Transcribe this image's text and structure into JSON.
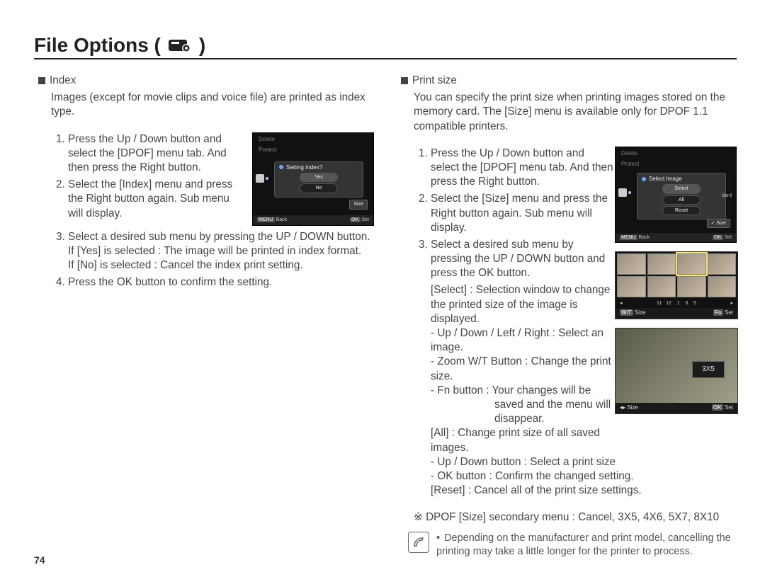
{
  "title": "File Options (",
  "title_close": ")",
  "page_number": "74",
  "left": {
    "heading": "Index",
    "intro": "Images (except for movie clips and voice file) are printed as index type.",
    "steps": {
      "s1": "Press the Up / Down button and select the [DPOF] menu tab. And then press the Right button.",
      "s2": "Select the [Index] menu and press the Right button again. Sub menu will display.",
      "s3a": "Select a desired sub menu by pressing the UP / DOWN button.",
      "s3b": "If [Yes] is selected : The image will be printed in index format.",
      "s3c": "If [No] is selected   : Cancel the index print setting.",
      "s4": "Press the OK button to confirm the setting."
    },
    "sshot": {
      "menu1": "Delete",
      "menu2": "Protect",
      "popup_title": "Setting Index?",
      "opt_yes": "Yes",
      "opt_no": "No",
      "right_tag": "Size",
      "footer_left": "Back",
      "footer_left_icon": "MENU",
      "footer_right": "Set",
      "footer_right_icon": "OK"
    }
  },
  "right": {
    "heading": "Print size",
    "intro": "You can specify the print size when printing images stored on the memory card. The [Size] menu is available only for DPOF 1.1 compatible printers.",
    "steps": {
      "s1": "Press the Up / Down button and select the [DPOF] menu tab. And then press the Right button.",
      "s2": "Select the [Size] menu and press the Right button again. Sub menu will display.",
      "s3a": "Select a desired sub menu by pressing the UP / DOWN button and press the OK button.",
      "s3_select_label": "[Select] : Selection window to change the printed size of the image is displayed.",
      "s3_b1": "- Up / Down / Left / Right : Select an image.",
      "s3_b2": "- Zoom W/T Button : Change the print size.",
      "s3_b3a": "- Fn button : Your changes will be",
      "s3_b3b": "saved and the menu will disappear.",
      "s3_all": "[All] : Change print size of all saved images.",
      "s3_all_b1": "- Up / Down button : Select a print size",
      "s3_all_b2": "- OK button : Confirm the changed setting.",
      "s3_reset": "[Reset] : Cancel all of the print size settings."
    },
    "secondary": "※ DPOF [Size] secondary menu : Cancel, 3X5, 4X6, 5X7, 8X10",
    "note": "Depending on the manufacturer and print model, cancelling the printing may take a little longer for the printer to process.",
    "sshot": {
      "menu1": "Delete",
      "menu2": "Protect",
      "popup_title": "Select Image",
      "opt1": "Select",
      "opt2": "All",
      "opt3": "Reset",
      "side_label": "dard",
      "right_tag": "✓ Size",
      "footer_left": "Back",
      "footer_left_icon": "MENU",
      "footer_right": "Set",
      "footer_right_icon": "OK"
    },
    "thumbbar": {
      "left": "Size",
      "left_icon": "W/T",
      "right": "Set",
      "right_icon": "Fn",
      "nums": "11   12    1    3    5"
    },
    "photo": {
      "plaque": "3X5",
      "bar_left": "Size",
      "bar_left_icon": "◂▸",
      "bar_right": "Set",
      "bar_right_icon": "OK"
    }
  }
}
